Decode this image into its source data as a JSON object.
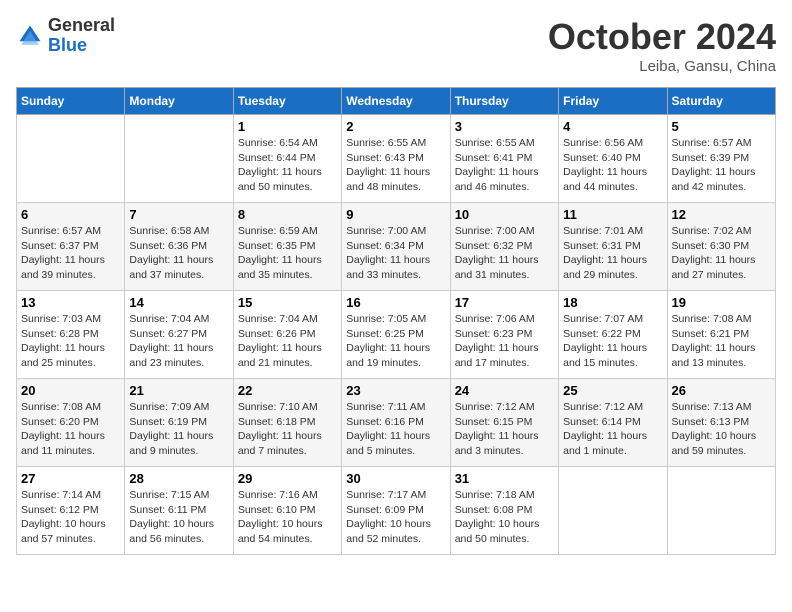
{
  "logo": {
    "general": "General",
    "blue": "Blue"
  },
  "title": "October 2024",
  "location": "Leiba, Gansu, China",
  "days_of_week": [
    "Sunday",
    "Monday",
    "Tuesday",
    "Wednesday",
    "Thursday",
    "Friday",
    "Saturday"
  ],
  "weeks": [
    [
      null,
      null,
      {
        "day": 1,
        "sunrise": "6:54 AM",
        "sunset": "6:44 PM",
        "daylight": "11 hours and 50 minutes."
      },
      {
        "day": 2,
        "sunrise": "6:55 AM",
        "sunset": "6:43 PM",
        "daylight": "11 hours and 48 minutes."
      },
      {
        "day": 3,
        "sunrise": "6:55 AM",
        "sunset": "6:41 PM",
        "daylight": "11 hours and 46 minutes."
      },
      {
        "day": 4,
        "sunrise": "6:56 AM",
        "sunset": "6:40 PM",
        "daylight": "11 hours and 44 minutes."
      },
      {
        "day": 5,
        "sunrise": "6:57 AM",
        "sunset": "6:39 PM",
        "daylight": "11 hours and 42 minutes."
      }
    ],
    [
      {
        "day": 6,
        "sunrise": "6:57 AM",
        "sunset": "6:37 PM",
        "daylight": "11 hours and 39 minutes."
      },
      {
        "day": 7,
        "sunrise": "6:58 AM",
        "sunset": "6:36 PM",
        "daylight": "11 hours and 37 minutes."
      },
      {
        "day": 8,
        "sunrise": "6:59 AM",
        "sunset": "6:35 PM",
        "daylight": "11 hours and 35 minutes."
      },
      {
        "day": 9,
        "sunrise": "7:00 AM",
        "sunset": "6:34 PM",
        "daylight": "11 hours and 33 minutes."
      },
      {
        "day": 10,
        "sunrise": "7:00 AM",
        "sunset": "6:32 PM",
        "daylight": "11 hours and 31 minutes."
      },
      {
        "day": 11,
        "sunrise": "7:01 AM",
        "sunset": "6:31 PM",
        "daylight": "11 hours and 29 minutes."
      },
      {
        "day": 12,
        "sunrise": "7:02 AM",
        "sunset": "6:30 PM",
        "daylight": "11 hours and 27 minutes."
      }
    ],
    [
      {
        "day": 13,
        "sunrise": "7:03 AM",
        "sunset": "6:28 PM",
        "daylight": "11 hours and 25 minutes."
      },
      {
        "day": 14,
        "sunrise": "7:04 AM",
        "sunset": "6:27 PM",
        "daylight": "11 hours and 23 minutes."
      },
      {
        "day": 15,
        "sunrise": "7:04 AM",
        "sunset": "6:26 PM",
        "daylight": "11 hours and 21 minutes."
      },
      {
        "day": 16,
        "sunrise": "7:05 AM",
        "sunset": "6:25 PM",
        "daylight": "11 hours and 19 minutes."
      },
      {
        "day": 17,
        "sunrise": "7:06 AM",
        "sunset": "6:23 PM",
        "daylight": "11 hours and 17 minutes."
      },
      {
        "day": 18,
        "sunrise": "7:07 AM",
        "sunset": "6:22 PM",
        "daylight": "11 hours and 15 minutes."
      },
      {
        "day": 19,
        "sunrise": "7:08 AM",
        "sunset": "6:21 PM",
        "daylight": "11 hours and 13 minutes."
      }
    ],
    [
      {
        "day": 20,
        "sunrise": "7:08 AM",
        "sunset": "6:20 PM",
        "daylight": "11 hours and 11 minutes."
      },
      {
        "day": 21,
        "sunrise": "7:09 AM",
        "sunset": "6:19 PM",
        "daylight": "11 hours and 9 minutes."
      },
      {
        "day": 22,
        "sunrise": "7:10 AM",
        "sunset": "6:18 PM",
        "daylight": "11 hours and 7 minutes."
      },
      {
        "day": 23,
        "sunrise": "7:11 AM",
        "sunset": "6:16 PM",
        "daylight": "11 hours and 5 minutes."
      },
      {
        "day": 24,
        "sunrise": "7:12 AM",
        "sunset": "6:15 PM",
        "daylight": "11 hours and 3 minutes."
      },
      {
        "day": 25,
        "sunrise": "7:12 AM",
        "sunset": "6:14 PM",
        "daylight": "11 hours and 1 minute."
      },
      {
        "day": 26,
        "sunrise": "7:13 AM",
        "sunset": "6:13 PM",
        "daylight": "10 hours and 59 minutes."
      }
    ],
    [
      {
        "day": 27,
        "sunrise": "7:14 AM",
        "sunset": "6:12 PM",
        "daylight": "10 hours and 57 minutes."
      },
      {
        "day": 28,
        "sunrise": "7:15 AM",
        "sunset": "6:11 PM",
        "daylight": "10 hours and 56 minutes."
      },
      {
        "day": 29,
        "sunrise": "7:16 AM",
        "sunset": "6:10 PM",
        "daylight": "10 hours and 54 minutes."
      },
      {
        "day": 30,
        "sunrise": "7:17 AM",
        "sunset": "6:09 PM",
        "daylight": "10 hours and 52 minutes."
      },
      {
        "day": 31,
        "sunrise": "7:18 AM",
        "sunset": "6:08 PM",
        "daylight": "10 hours and 50 minutes."
      },
      null,
      null
    ]
  ]
}
